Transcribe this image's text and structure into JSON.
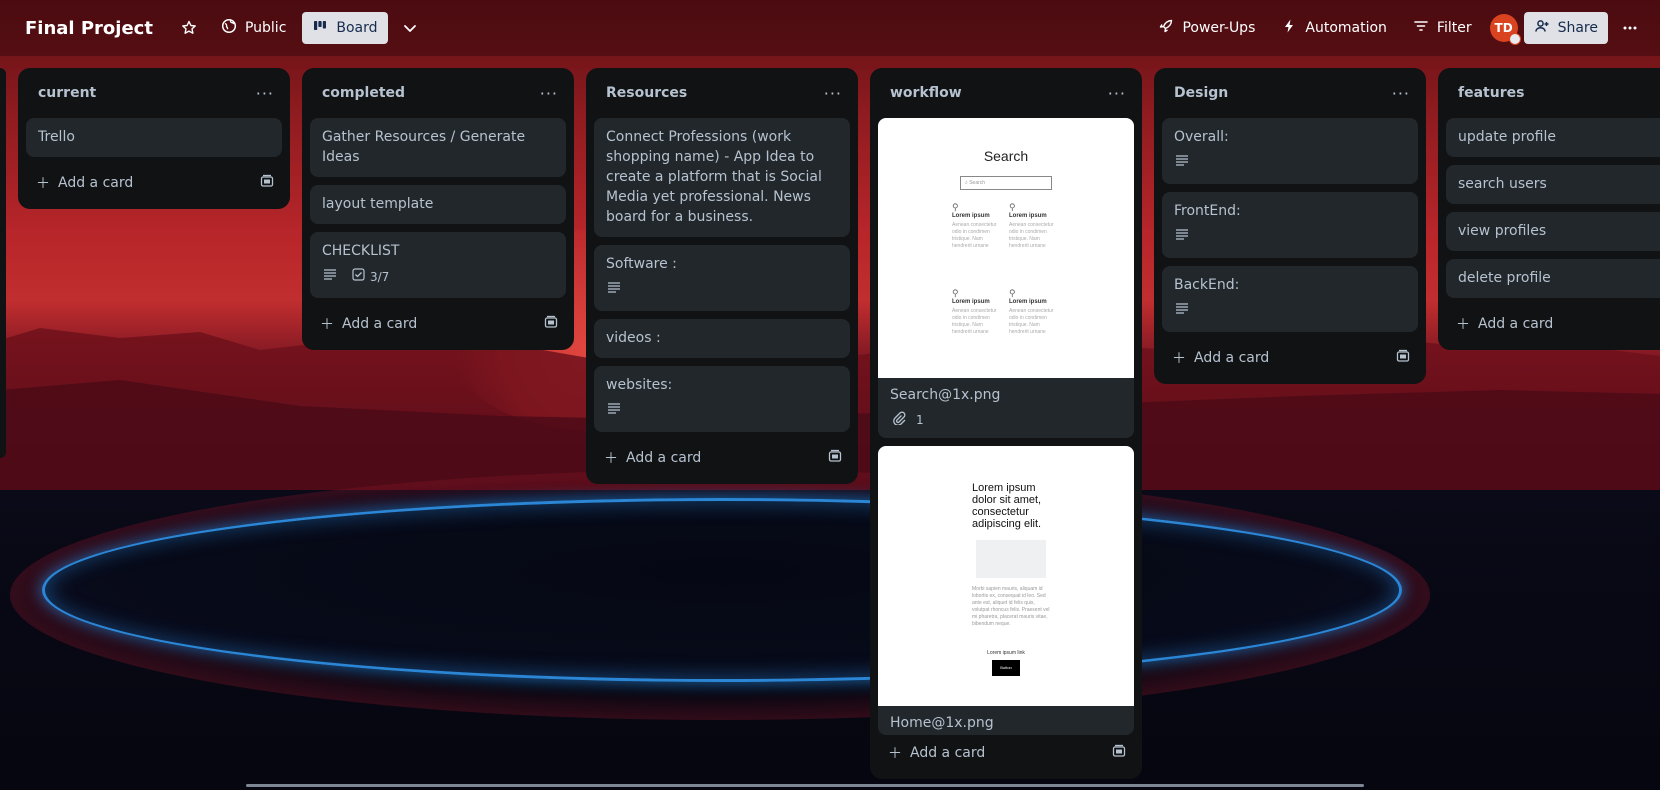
{
  "header": {
    "board_title": "Final Project",
    "visibility_label": "Public",
    "view_label": "Board",
    "powerups_label": "Power-Ups",
    "automation_label": "Automation",
    "filter_label": "Filter",
    "avatar_initials": "TD",
    "share_label": "Share"
  },
  "lists": [
    {
      "title": "current",
      "cards": [
        {
          "text": "Trello"
        }
      ],
      "add_label": "Add a card"
    },
    {
      "title": "completed",
      "cards": [
        {
          "text": "Gather Resources / Generate Ideas"
        },
        {
          "text": "layout template"
        },
        {
          "text": "CHECKLIST",
          "checklist": "3/7"
        }
      ],
      "add_label": "Add a card"
    },
    {
      "title": "Resources",
      "cards": [
        {
          "text": "Connect Professions (work shopping name) - App Idea to create a platform that is Social Media yet professional. News board for a business."
        },
        {
          "text": "Software :"
        },
        {
          "text": "videos :"
        },
        {
          "text": "websites:"
        }
      ],
      "add_label": "Add a card"
    },
    {
      "title": "workflow",
      "cards": [
        {
          "text": "Search@1x.png",
          "attachments": "1",
          "preview": {
            "heading": "Search",
            "search_placeholder": "Search",
            "item_title": "Lorem ipsum",
            "item_body": "Aenean consectetur odio in condimen tristique. Nam hendrerit urnane"
          }
        },
        {
          "text": "Home@1x.png",
          "preview": {
            "heading": "Lorem ipsum dolor sit amet, consectetur adipiscing elit.",
            "body": "Morbi sapien mauris, aliquam id lobortis ex, consequat id leo. Sed ante est, aliquet id felis quis, volutpat rhoncus felis. Praesent vel mi pharetra, placerat mauris vitae, bibendum neque.",
            "link": "Lorem ipsum link",
            "button": "Button"
          }
        }
      ],
      "add_label": "Add a card"
    },
    {
      "title": "Design",
      "cards": [
        {
          "text": "Overall:"
        },
        {
          "text": "FrontEnd:"
        },
        {
          "text": "BackEnd:"
        }
      ],
      "add_label": "Add a card"
    },
    {
      "title": "features",
      "cards": [
        {
          "text": "update profile"
        },
        {
          "text": "search users"
        },
        {
          "text": "view profiles"
        },
        {
          "text": "delete profile"
        }
      ],
      "add_label": "Add a card"
    }
  ],
  "icons": {
    "star": "star-icon",
    "globe": "globe-icon",
    "board": "board-icon",
    "chevron": "chevron-down-icon",
    "rocket": "rocket-icon",
    "bolt": "bolt-icon",
    "filter": "filter-icon",
    "more": "more-icon",
    "plus": "plus-icon",
    "template": "template-icon",
    "description": "description-icon",
    "checklist": "checklist-icon",
    "attachment": "attachment-icon"
  },
  "colors": {
    "list_bg": "#111214",
    "card_bg": "#22272b",
    "text": "#b6c2cf",
    "avatar": "#d9431f"
  }
}
